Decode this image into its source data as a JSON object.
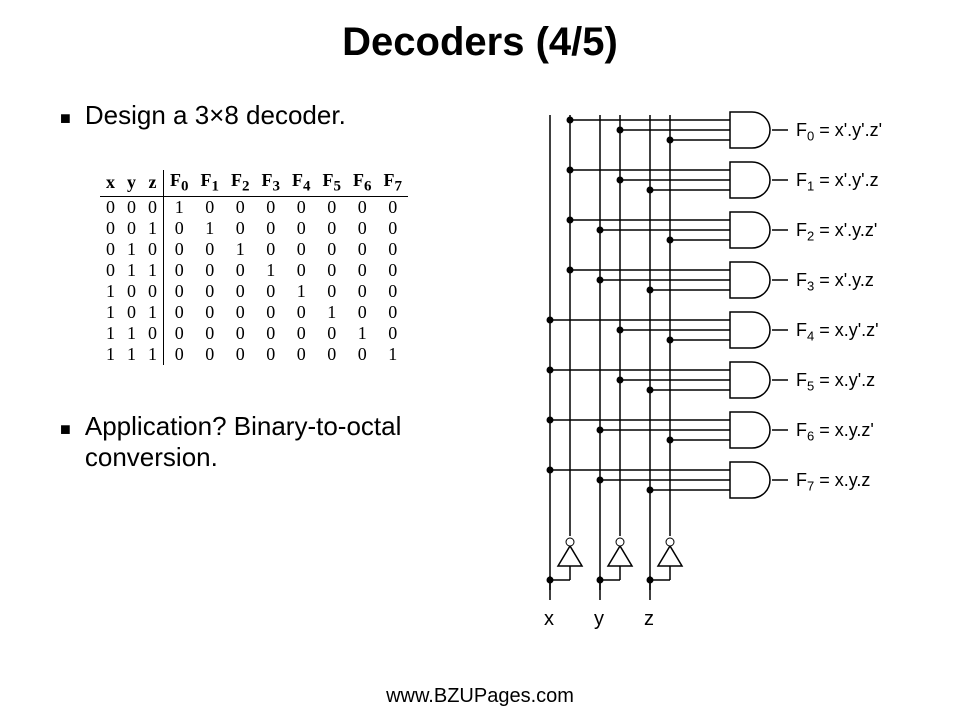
{
  "title": "Decoders (4/5)",
  "bullet1": "Design a 3×8 decoder.",
  "bullet2": "Application?  Binary-to-octal conversion.",
  "footer": "www.BZUPages.com",
  "truth_headers": [
    "x",
    "y",
    "z",
    "F0",
    "F1",
    "F2",
    "F3",
    "F4",
    "F5",
    "F6",
    "F7"
  ],
  "truth_rows": [
    [
      "0",
      "0",
      "0",
      "1",
      "0",
      "0",
      "0",
      "0",
      "0",
      "0",
      "0"
    ],
    [
      "0",
      "0",
      "1",
      "0",
      "1",
      "0",
      "0",
      "0",
      "0",
      "0",
      "0"
    ],
    [
      "0",
      "1",
      "0",
      "0",
      "0",
      "1",
      "0",
      "0",
      "0",
      "0",
      "0"
    ],
    [
      "0",
      "1",
      "1",
      "0",
      "0",
      "0",
      "1",
      "0",
      "0",
      "0",
      "0"
    ],
    [
      "1",
      "0",
      "0",
      "0",
      "0",
      "0",
      "0",
      "1",
      "0",
      "0",
      "0"
    ],
    [
      "1",
      "0",
      "1",
      "0",
      "0",
      "0",
      "0",
      "0",
      "1",
      "0",
      "0"
    ],
    [
      "1",
      "1",
      "0",
      "0",
      "0",
      "0",
      "0",
      "0",
      "0",
      "1",
      "0"
    ],
    [
      "1",
      "1",
      "1",
      "0",
      "0",
      "0",
      "0",
      "0",
      "0",
      "0",
      "1"
    ]
  ],
  "outputs": [
    {
      "sub": "0",
      "expr": " = x'.y'.z'"
    },
    {
      "sub": "1",
      "expr": " = x'.y'.z"
    },
    {
      "sub": "2",
      "expr": " = x'.y.z'"
    },
    {
      "sub": "3",
      "expr": " = x'.y.z"
    },
    {
      "sub": "4",
      "expr": " = x.y'.z'"
    },
    {
      "sub": "5",
      "expr": " = x.y'.z"
    },
    {
      "sub": "6",
      "expr": " = x.y.z'"
    },
    {
      "sub": "7",
      "expr": " = x.y.z"
    }
  ],
  "inputs": {
    "x": "x",
    "y": "y",
    "z": "z"
  }
}
